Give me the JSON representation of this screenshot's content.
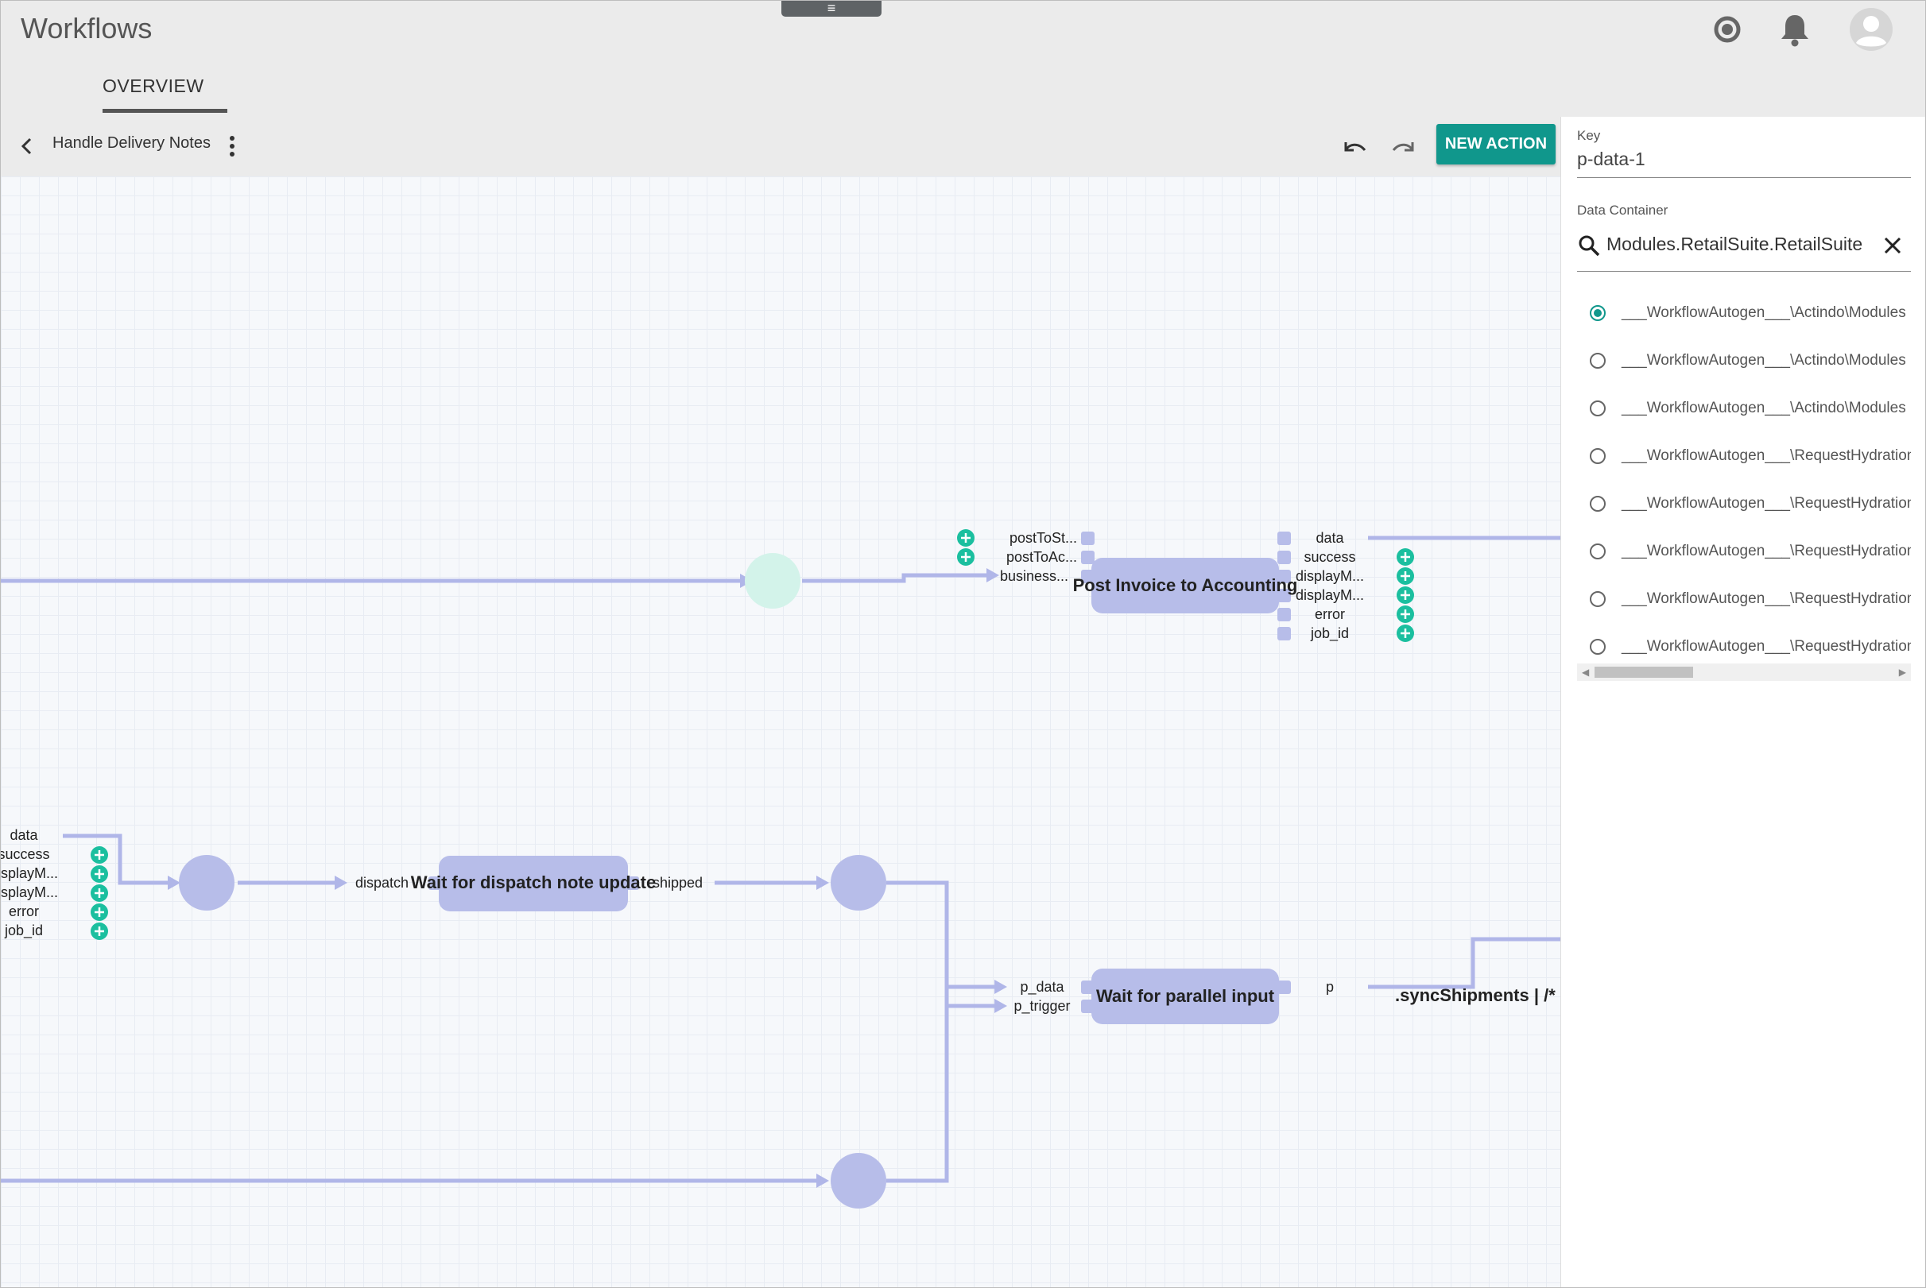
{
  "app": {
    "title": "Workflows",
    "menu_glyph": "≡"
  },
  "header_icons": [
    "radio-button-icon",
    "bell-icon",
    "account-avatar-icon"
  ],
  "tabs": [
    {
      "label": "OVERVIEW",
      "active": true
    }
  ],
  "toolbar": {
    "workflow_name": "Handle Delivery Notes",
    "new_action_label": "NEW ACTION"
  },
  "panel": {
    "key_label": "Key",
    "key_value": "p-data-1",
    "container_label": "Data Container",
    "search_value": "Modules.RetailSuite.RetailSuite",
    "options": [
      {
        "label": "___WorkflowAutogen___\\Actindo\\Modules",
        "selected": true
      },
      {
        "label": "___WorkflowAutogen___\\Actindo\\Modules",
        "selected": false
      },
      {
        "label": "___WorkflowAutogen___\\Actindo\\Modules",
        "selected": false
      },
      {
        "label": "___WorkflowAutogen___\\RequestHydration",
        "selected": false
      },
      {
        "label": "___WorkflowAutogen___\\RequestHydration",
        "selected": false
      },
      {
        "label": "___WorkflowAutogen___\\RequestHydration",
        "selected": false
      },
      {
        "label": "___WorkflowAutogen___\\RequestHydration",
        "selected": false
      },
      {
        "label": "___WorkflowAutogen___\\RequestHydration",
        "selected": false
      }
    ]
  },
  "canvas": {
    "node_post_invoice": {
      "title": "Post Invoice to Accounting",
      "inputs": [
        "postToSt...",
        "postToAc...",
        "business..."
      ],
      "outputs": [
        "data",
        "success",
        "displayM...",
        "displayM...",
        "error",
        "job_id"
      ]
    },
    "node_left": {
      "outputs": [
        "data",
        "success",
        "displayM...",
        "displayM...",
        "error",
        "job_id"
      ]
    },
    "node_wait_dispatch": {
      "title": "Wait for dispatch note update",
      "input": "dispatch",
      "output": "shipped"
    },
    "node_wait_parallel": {
      "title": "Wait for parallel input",
      "inputs": [
        "p_data",
        "p_trigger"
      ],
      "output": "p"
    },
    "sync_label": ".syncShipments | /*"
  },
  "colors": {
    "accent": "#10978c",
    "node_fill": "#b7bde9",
    "edge": "#b0b6e8",
    "plus": "#1bbf9f",
    "start_node": "#d3f3ea"
  }
}
